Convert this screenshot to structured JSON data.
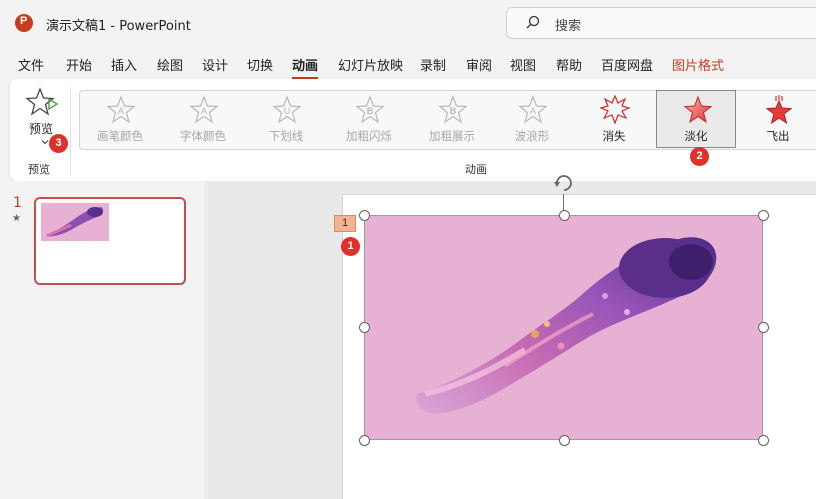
{
  "app": {
    "doc_title": "演示文稿1  -  PowerPoint",
    "search_placeholder": "搜索"
  },
  "menu": {
    "tabs": [
      {
        "label": "文件"
      },
      {
        "label": "开始"
      },
      {
        "label": "插入"
      },
      {
        "label": "绘图"
      },
      {
        "label": "设计"
      },
      {
        "label": "切换"
      },
      {
        "label": "动画"
      },
      {
        "label": "幻灯片放映"
      },
      {
        "label": "录制"
      },
      {
        "label": "审阅"
      },
      {
        "label": "视图"
      },
      {
        "label": "帮助"
      },
      {
        "label": "百度网盘"
      },
      {
        "label": "图片格式"
      }
    ],
    "active_tab": "动画",
    "context_tab": "图片格式"
  },
  "ribbon": {
    "preview": {
      "label": "预览",
      "group_label": "预览"
    },
    "animation_group_label": "动画",
    "animations": [
      {
        "label": "画笔颜色",
        "letter": "A",
        "enabled": false
      },
      {
        "label": "字体颜色",
        "letter": "A",
        "enabled": false
      },
      {
        "label": "下划线",
        "letter": "U",
        "enabled": false
      },
      {
        "label": "加粗闪烁",
        "letter": "B",
        "enabled": false
      },
      {
        "label": "加粗展示",
        "letter": "B",
        "enabled": false
      },
      {
        "label": "波浪形",
        "letter": "A",
        "enabled": false
      },
      {
        "label": "消失",
        "letter": "",
        "enabled": true
      },
      {
        "label": "淡化",
        "letter": "",
        "enabled": true,
        "selected": true
      },
      {
        "label": "飞出",
        "letter": "",
        "enabled": true
      }
    ]
  },
  "badges": {
    "one": "1",
    "two": "2",
    "three": "3"
  },
  "slides_pane": {
    "slide_number": "1",
    "slide_marker": "★"
  },
  "slide": {
    "animation_tag": "1"
  },
  "colors": {
    "accent": "#c43e1c",
    "badge": "#e0302a",
    "picture_bg": "#e6b1d2"
  }
}
